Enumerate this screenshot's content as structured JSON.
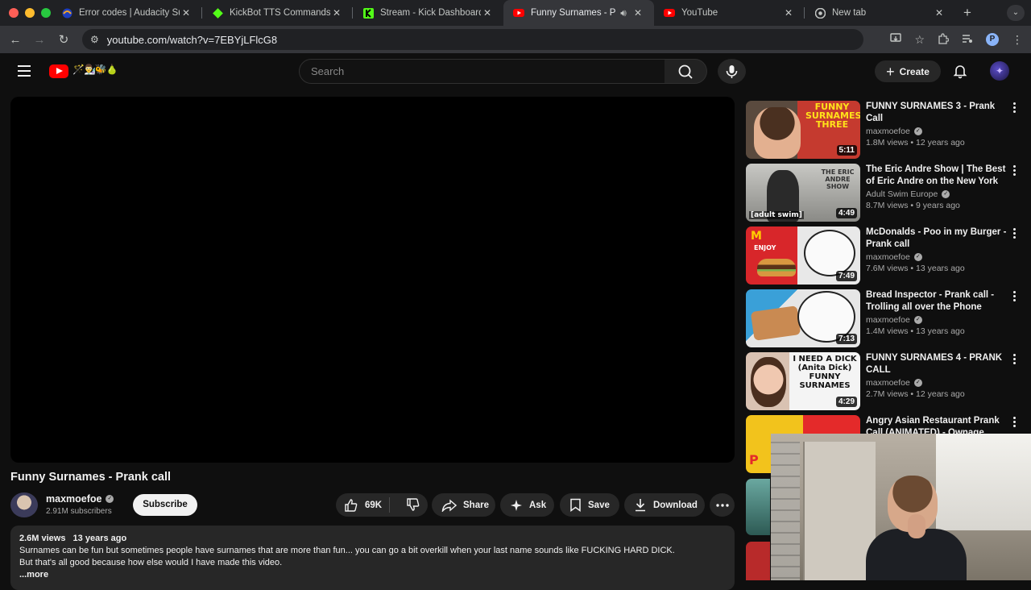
{
  "browser": {
    "tabs": [
      {
        "title": "Error codes | Audacity Sup",
        "favicon": "audacity",
        "active": false
      },
      {
        "title": "KickBot TTS Commands",
        "favicon": "kickbot",
        "active": false
      },
      {
        "title": "Stream - Kick Dashboard",
        "favicon": "kick",
        "active": false
      },
      {
        "title": "Funny Surnames - Pra",
        "favicon": "youtube",
        "active": true,
        "audio": true
      },
      {
        "title": "YouTube",
        "favicon": "youtube",
        "active": false
      },
      {
        "title": "New tab",
        "favicon": "chrome",
        "active": false
      }
    ],
    "url": "youtube.com/watch?v=7EBYjLFlcG8",
    "profile_initial": "P"
  },
  "masthead": {
    "search_placeholder": "Search",
    "create_label": "Create"
  },
  "video": {
    "title": "Funny Surnames - Prank call",
    "channel": "maxmoefoe",
    "subscribers": "2.91M subscribers",
    "subscribe_label": "Subscribe",
    "likes": "69K",
    "share_label": "Share",
    "ask_label": "Ask",
    "save_label": "Save",
    "download_label": "Download",
    "views": "2.6M views",
    "age": "13 years ago",
    "description_line1": "Surnames can be fun but sometimes people have surnames that are more than fun... you can go a bit overkill when your last name sounds like FUCKING HARD DICK.",
    "description_line2": "But that's all good because how else would I have made this video.",
    "more_label": "...more"
  },
  "recommendations": [
    {
      "title": "FUNNY SURNAMES 3 - Prank Call",
      "channel": "maxmoefoe",
      "verified": true,
      "stats": "1.8M views • 12 years ago",
      "duration": "5:11",
      "thumb_text": "FUNNY SURNAMES THREE"
    },
    {
      "title": "The Eric Andre Show | The Best of Eric Andre on the New York ...",
      "channel": "Adult Swim Europe",
      "verified": true,
      "stats": "8.7M views • 9 years ago",
      "duration": "4:49",
      "thumb_text": "THE ERIC ANDRE SHOW",
      "thumb_badge": "[adult swim]"
    },
    {
      "title": "McDonalds - Poo in my Burger - Prank call",
      "channel": "maxmoefoe",
      "verified": true,
      "stats": "7.6M views • 13 years ago",
      "duration": "7:49",
      "thumb_text": "ENJOY"
    },
    {
      "title": "Bread Inspector - Prank call - Trolling all over the Phone",
      "channel": "maxmoefoe",
      "verified": true,
      "stats": "1.4M views • 13 years ago",
      "duration": "7:13",
      "thumb_text": ""
    },
    {
      "title": "FUNNY SURNAMES 4 - PRANK CALL",
      "channel": "maxmoefoe",
      "verified": true,
      "stats": "2.7M views • 12 years ago",
      "duration": "4:29",
      "thumb_text": "I NEED A DICK (Anita Dick) FUNNY SURNAMES"
    },
    {
      "title": "Angry Asian Restaurant Prank Call (ANIMATED) - Ownage ...",
      "channel": "",
      "verified": false,
      "stats": "",
      "duration": "",
      "thumb_text": ""
    }
  ],
  "colors": {
    "background": "#0f0f0f",
    "surface": "#272727",
    "youtube_red": "#ff0000",
    "text_primary": "#f1f1f1",
    "text_secondary": "#aaaaaa"
  }
}
